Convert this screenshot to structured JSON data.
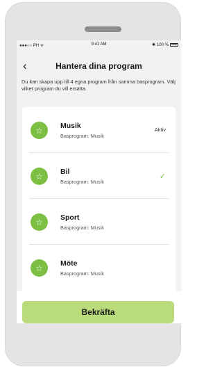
{
  "status_bar": {
    "carrier": "●●●○○ PH ᯤ",
    "time": "9:41 AM",
    "bluetooth": "✱",
    "battery": "100 %"
  },
  "header": {
    "back_icon": "‹",
    "title": "Hantera dina program"
  },
  "description": "Du kan skapa upp till 4 egna program från samma basprogram. Välj vilket program du vill ersätta.",
  "programs": [
    {
      "name": "Musik",
      "base": "Basprogram: Musik",
      "status": "Aktiv",
      "selected": false
    },
    {
      "name": "Bil",
      "base": "Basprogram: Musik",
      "status": "",
      "selected": true
    },
    {
      "name": "Sport",
      "base": "Basprogram: Musik",
      "status": "",
      "selected": false
    },
    {
      "name": "Möte",
      "base": "Basprogram: Musik",
      "status": "",
      "selected": false
    }
  ],
  "icons": {
    "program": "star-icon",
    "selected": "checkmark-icon",
    "star_glyph": "☆",
    "check_glyph": "✓"
  },
  "confirm_label": "Bekräfta",
  "colors": {
    "accent": "#7cbf42",
    "button": "#b9db7b",
    "device": "#e4e4e4",
    "screen": "#f2f2f2"
  }
}
